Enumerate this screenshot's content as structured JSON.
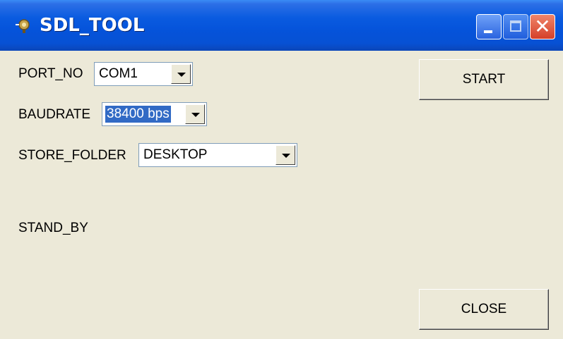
{
  "window": {
    "title": "SDL_TOOL",
    "app_icon": "gear-icon"
  },
  "titlebar_buttons": {
    "minimize_icon": "minimize-icon",
    "maximize_icon": "maximize-icon",
    "close_icon": "close-icon",
    "close_glyph": "✕"
  },
  "form": {
    "port_no": {
      "label": "PORT_NO",
      "value": "COM1"
    },
    "baudrate": {
      "label": "BAUDRATE",
      "value": "38400 bps"
    },
    "store_folder": {
      "label": "STORE_FOLDER",
      "value": "DESKTOP"
    },
    "status": "STAND_BY"
  },
  "buttons": {
    "start": "START",
    "close": "CLOSE"
  },
  "colors": {
    "titlebar_accent": "#0553da",
    "window_bg": "#ece9d8",
    "selection": "#316ac5"
  }
}
